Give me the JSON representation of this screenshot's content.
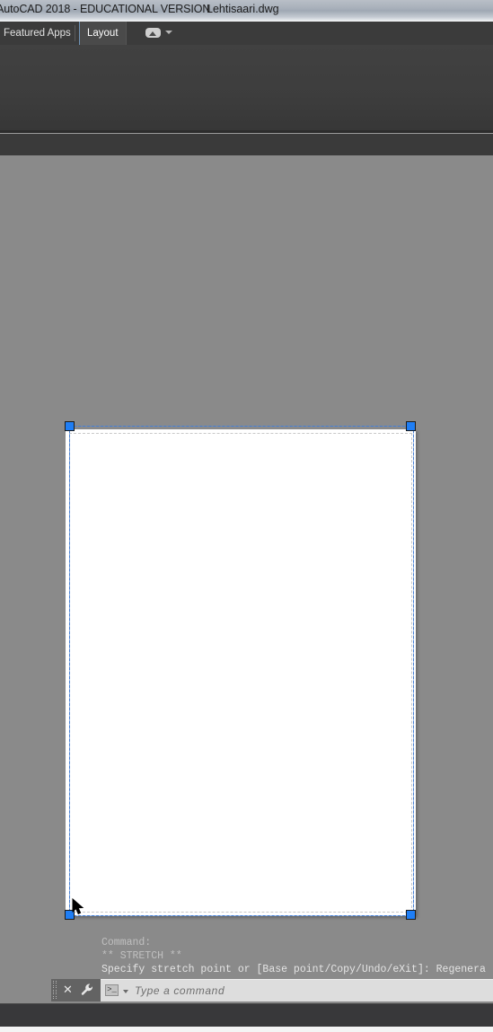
{
  "titlebar": {
    "app_title": "AutoCAD 2018 - EDUCATIONAL VERSION",
    "file_name": "Lehtisaari.dwg"
  },
  "ribbon": {
    "tabs": [
      {
        "label": "Featured Apps",
        "active": false
      },
      {
        "label": "Layout",
        "active": true
      }
    ],
    "icon_name": "panel-toggle-icon",
    "chevron_name": "chevron-down-icon"
  },
  "canvas": {
    "background_color": "#8a8a8a",
    "paper_color": "#ffffff",
    "selection_color": "#2f6fd0",
    "grip_color": "#1f7ef5",
    "grips": [
      "top-left",
      "top-right",
      "bottom-left",
      "bottom-right"
    ]
  },
  "command_history": [
    {
      "text": "Command:",
      "active": false
    },
    {
      "text": "** STRETCH **",
      "active": false
    },
    {
      "text": "Specify stretch point or [Base point/Copy/Undo/eXit]: Regenera",
      "active": true
    }
  ],
  "command_bar": {
    "close_label": "✕",
    "wrench_name": "wrench-icon",
    "prompt_symbol": ">_",
    "placeholder": "Type a command",
    "value": ""
  }
}
